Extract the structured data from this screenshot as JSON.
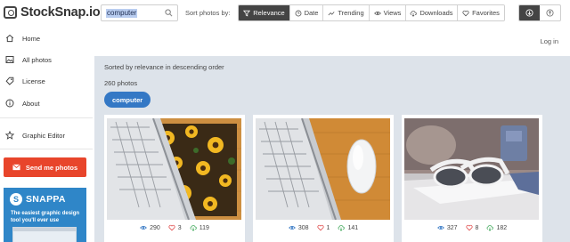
{
  "app": {
    "name": "StockSnap.io"
  },
  "search": {
    "value": "computer"
  },
  "sort": {
    "label": "Sort photos by:",
    "options": [
      "Relevance",
      "Date",
      "Trending",
      "Views",
      "Downloads",
      "Favorites"
    ],
    "active": "Relevance"
  },
  "sidebar": {
    "items": [
      {
        "label": "Home",
        "icon": "home-icon"
      },
      {
        "label": "All photos",
        "icon": "photos-icon"
      },
      {
        "label": "License",
        "icon": "license-icon"
      },
      {
        "label": "About",
        "icon": "info-icon"
      },
      {
        "label": "Graphic Editor",
        "icon": "star-icon"
      }
    ],
    "cta": "Send me photos",
    "ad": {
      "brand": "SNAPPA",
      "tagline": "The easiest graphic design tool you'll ever use"
    }
  },
  "header": {
    "login": "Log in"
  },
  "main": {
    "sorted_text": "Sorted by relevance in descending order",
    "count_text": "260 photos",
    "tag": "computer"
  },
  "photos": [
    {
      "views": "290",
      "likes": "3",
      "downloads": "119"
    },
    {
      "views": "308",
      "likes": "1",
      "downloads": "141"
    },
    {
      "views": "327",
      "likes": "8",
      "downloads": "182"
    }
  ],
  "colors": {
    "accent": "#3478c5",
    "cta": "#e8452b",
    "dark_button": "#444444",
    "content_bg": "#dde3ea"
  }
}
